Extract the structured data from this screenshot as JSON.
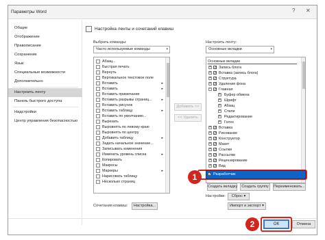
{
  "window": {
    "title": "Параметры Word",
    "help": "?",
    "close": "✕"
  },
  "sidebar": {
    "items": [
      {
        "label": "Общие"
      },
      {
        "label": "Отображение"
      },
      {
        "label": "Правописание"
      },
      {
        "label": "Сохранение"
      },
      {
        "label": "Язык"
      },
      {
        "label": "Специальные возможности"
      },
      {
        "label": "Дополнительно"
      },
      {
        "label": "Настроить ленту"
      },
      {
        "label": "Панель быстрого доступа"
      },
      {
        "label": "Надстройки"
      },
      {
        "label": "Центр управления безопасностью"
      }
    ]
  },
  "main": {
    "header": "Настройка ленты и сочетаний клавиш",
    "choose_label": "Выбрать команды:",
    "choose_value": "Часто используемые команды",
    "customize_label": "Настроить ленту:",
    "customize_value": "Основные вкладки",
    "commands": [
      {
        "label": "Абзац...",
        "sub": ""
      },
      {
        "label": "Быстрая печать",
        "sub": ""
      },
      {
        "label": "Вернуть",
        "sub": ""
      },
      {
        "label": "Вертикальное текстовое поле",
        "sub": ""
      },
      {
        "label": "Вставить",
        "sub": "▸"
      },
      {
        "label": "Вставить",
        "sub": "▸"
      },
      {
        "label": "Вставить примечание",
        "sub": ""
      },
      {
        "label": "Вставить разрывы страниц...",
        "sub": "▸"
      },
      {
        "label": "Вставить рисунок",
        "sub": ""
      },
      {
        "label": "Вставить таблицу",
        "sub": "▸"
      },
      {
        "label": "Вставить по умолчанию...",
        "sub": ""
      },
      {
        "label": "Вырезать",
        "sub": ""
      },
      {
        "label": "Выровнять по левому краю",
        "sub": ""
      },
      {
        "label": "Выровнять по центру",
        "sub": ""
      },
      {
        "label": "Добавить таблицу",
        "sub": "▸"
      },
      {
        "label": "Задать начальное значение...",
        "sub": ""
      },
      {
        "label": "Записывать изменения",
        "sub": ""
      },
      {
        "label": "Изменить уровень списка",
        "sub": "▸"
      },
      {
        "label": "Копировать",
        "sub": ""
      },
      {
        "label": "Макросы",
        "sub": ""
      },
      {
        "label": "Маркеры",
        "sub": "▸"
      },
      {
        "label": "Нарисовать таблицу",
        "sub": ""
      },
      {
        "label": "Несколько страниц",
        "sub": ""
      }
    ],
    "add_button": "Добавить >>",
    "remove_button": "<< Удалить",
    "tabs_header": "Основные вкладки",
    "tabs": [
      {
        "label": "Запись блога",
        "level": 0,
        "pm": "+",
        "checked": true
      },
      {
        "label": "Вставка (запись блога)",
        "level": 0,
        "pm": "+",
        "checked": true
      },
      {
        "label": "Структура",
        "level": 0,
        "pm": "+",
        "checked": true
      },
      {
        "label": "Удаление фона",
        "level": 0,
        "pm": "+",
        "checked": true
      },
      {
        "label": "Главная",
        "level": 0,
        "pm": "−",
        "checked": true
      },
      {
        "label": "Буфер обмена",
        "level": 1,
        "pm": "+",
        "checked": false
      },
      {
        "label": "Шрифт",
        "level": 1,
        "pm": "+",
        "checked": false
      },
      {
        "label": "Абзац",
        "level": 1,
        "pm": "+",
        "checked": false
      },
      {
        "label": "Стили",
        "level": 1,
        "pm": "+",
        "checked": false
      },
      {
        "label": "Редактирование",
        "level": 1,
        "pm": "+",
        "checked": false
      },
      {
        "label": "Голос",
        "level": 1,
        "pm": "+",
        "checked": false
      },
      {
        "label": "Вставка",
        "level": 0,
        "pm": "+",
        "checked": true
      },
      {
        "label": "Рисование",
        "level": 0,
        "pm": "+",
        "checked": true
      },
      {
        "label": "Конструктор",
        "level": 0,
        "pm": "+",
        "checked": true
      },
      {
        "label": "Макет",
        "level": 0,
        "pm": "+",
        "checked": true
      },
      {
        "label": "Ссылки",
        "level": 0,
        "pm": "+",
        "checked": true
      },
      {
        "label": "Рассылки",
        "level": 0,
        "pm": "+",
        "checked": true
      },
      {
        "label": "Рецензирование",
        "level": 0,
        "pm": "+",
        "checked": true
      },
      {
        "label": "Вид",
        "level": 0,
        "pm": "+",
        "checked": true
      }
    ],
    "selected_tab": "Разработчик",
    "new_tab_button": "Создать вкладку",
    "new_group_button": "Создать группу",
    "rename_button": "Переименовать...",
    "settings_label": "Настройки:",
    "reset_button": "Сброс ▾",
    "import_export_button": "Импорт и экспорт ▾",
    "shortcuts_label": "Сочетания клавиш:",
    "shortcuts_button": "Настройка..."
  },
  "badges": {
    "one": "1",
    "two": "2"
  },
  "footer": {
    "ok": "ОК",
    "cancel": "Отмена"
  },
  "colors": {
    "selection": "#0e64c4",
    "callout": "#d0261d"
  }
}
